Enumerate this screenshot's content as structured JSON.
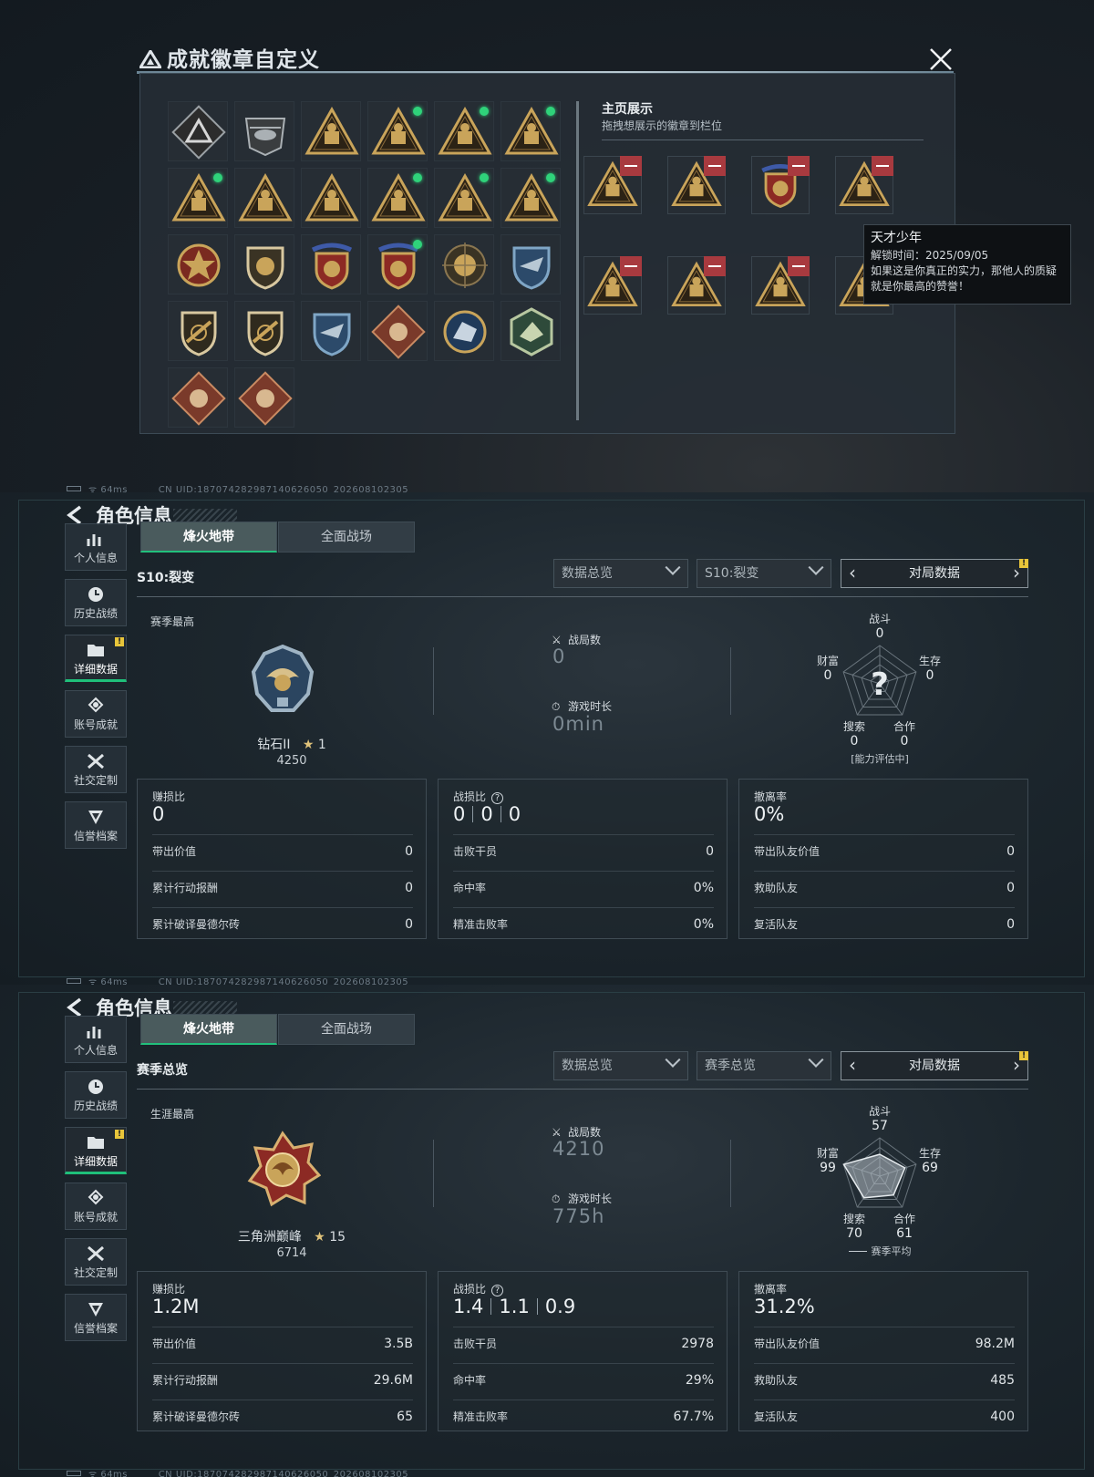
{
  "badge_modal": {
    "title": "成就徽章自定义",
    "showcase_title": "主页展示",
    "showcase_subtitle": "拖拽想展示的徽章到栏位",
    "tooltip": {
      "title": "天才少年",
      "unlock_time": "解锁时间：2025/09/05",
      "description": "如果这是你真正的实力，那他人的质疑就是你最高的赞誉！"
    },
    "badge_icons": [
      "triangle-emblem-icon",
      "helicopter-badge-icon",
      "map-badge-icon",
      "kit-58-badge-icon",
      "vehicle-badge-icon",
      "soldier-badge-icon",
      "eri-globe-badge-icon",
      "helmet-badge-icon",
      "number-one-badge-icon",
      "flashlight-badge-icon",
      "gear-hands-badge-icon",
      "team-badge-icon",
      "star-medal-icon",
      "shield-emblem-icon",
      "red-eagle-crest-icon",
      "red-star-crest-icon",
      "target-medal-icon",
      "blue-hawk-crest-icon",
      "rifle-shield-icon",
      "scope-shield-icon",
      "blue-crest-icon",
      "wolf-diamond-icon",
      "wolf-round-icon",
      "dragon-hex-icon",
      "beast-diamond-icon",
      "runner-diamond-icon"
    ],
    "badge_new_dots": [
      3,
      4,
      5,
      6,
      9,
      10,
      11,
      15
    ],
    "showcase_icons": [
      "gear-hands-badge-icon",
      "team-badge-icon",
      "red-eagle-crest-icon",
      "flashlight-badge-icon",
      "kit-58-badge-icon",
      "vehicle-badge-icon",
      "soldier-badge-icon",
      "flashlight-badge-icon"
    ]
  },
  "footer": {
    "ping": "64ms",
    "uid": "CN UID:1870742829871406260​50_202608102305"
  },
  "nav_items": [
    "个人信息",
    "历史战绩",
    "详细数据",
    "账号成就",
    "社交定制",
    "信誉档案"
  ],
  "nav_icons": [
    "bar-chart-icon",
    "clock-icon",
    "folder-icon",
    "medal-icon",
    "wrench-icon",
    "shield-icon"
  ],
  "panels": [
    {
      "page_title": "角色信息",
      "tabs": [
        "烽火地带",
        "全面战场"
      ],
      "section_title": "S10:裂变",
      "dropdown_1": "数据总览",
      "dropdown_2": "S10:裂变",
      "pager_label": "对局数据",
      "rank_label": "赛季最高",
      "rank_name": "钻石II",
      "rank_stars": "1",
      "rank_points": "4250",
      "matches_label": "战局数",
      "matches_value": "0",
      "playtime_label": "游戏时长",
      "playtime_value": "0min",
      "radar": {
        "labels": [
          "战斗",
          "生存",
          "合作",
          "搜索",
          "财富"
        ],
        "values": [
          "0",
          "0",
          "0",
          "0",
          "0"
        ],
        "value_nums": [
          0,
          0,
          0,
          0,
          0
        ],
        "note": "[能力评估中]"
      },
      "card1": {
        "head": "赚损比",
        "value": "0",
        "rows": [
          [
            "带出价值",
            "0"
          ],
          [
            "累计行动报酬",
            "0"
          ],
          [
            "累计破译曼德尔砖",
            "0"
          ]
        ]
      },
      "card2": {
        "head": "战损比",
        "values": [
          "0",
          "0",
          "0"
        ],
        "rows": [
          [
            "击败干员",
            "0"
          ],
          [
            "命中率",
            "0%"
          ],
          [
            "精准击败率",
            "0%"
          ]
        ]
      },
      "card3": {
        "head": "撤离率",
        "value": "0%",
        "rows": [
          [
            "带出队友价值",
            "0"
          ],
          [
            "救助队友",
            "0"
          ],
          [
            "复活队友",
            "0"
          ]
        ]
      }
    },
    {
      "page_title": "角色信息",
      "tabs": [
        "烽火地带",
        "全面战场"
      ],
      "section_title": "赛季总览",
      "dropdown_1": "数据总览",
      "dropdown_2": "赛季总览",
      "pager_label": "对局数据",
      "rank_label": "生涯最高",
      "rank_name": "三角洲巅峰",
      "rank_stars": "15",
      "rank_points": "6714",
      "matches_label": "战局数",
      "matches_value": "4210",
      "playtime_label": "游戏时长",
      "playtime_value": "775h",
      "radar": {
        "labels": [
          "战斗",
          "生存",
          "合作",
          "搜索",
          "财富"
        ],
        "values": [
          "57",
          "69",
          "61",
          "70",
          "99"
        ],
        "value_nums": [
          57,
          69,
          61,
          70,
          99
        ],
        "note": "赛季平均"
      },
      "card1": {
        "head": "赚损比",
        "value": "1.2M",
        "rows": [
          [
            "带出价值",
            "3.5B"
          ],
          [
            "累计行动报酬",
            "29.6M"
          ],
          [
            "累计破译曼德尔砖",
            "65"
          ]
        ]
      },
      "card2": {
        "head": "战损比",
        "values": [
          "1.4",
          "1.1",
          "0.9"
        ],
        "rows": [
          [
            "击败干员",
            "2978"
          ],
          [
            "命中率",
            "29%"
          ],
          [
            "精准击败率",
            "67.7%"
          ]
        ]
      },
      "card3": {
        "head": "撤离率",
        "value": "31.2%",
        "rows": [
          [
            "带出队友价值",
            "98.2M"
          ],
          [
            "救助队友",
            "485"
          ],
          [
            "复活队友",
            "400"
          ]
        ]
      }
    }
  ],
  "colors": {
    "accent_green": "#22c07c",
    "gold": "#c9a45a",
    "dot_green": "#2fd27a",
    "remove_red": "#a83a3f"
  }
}
